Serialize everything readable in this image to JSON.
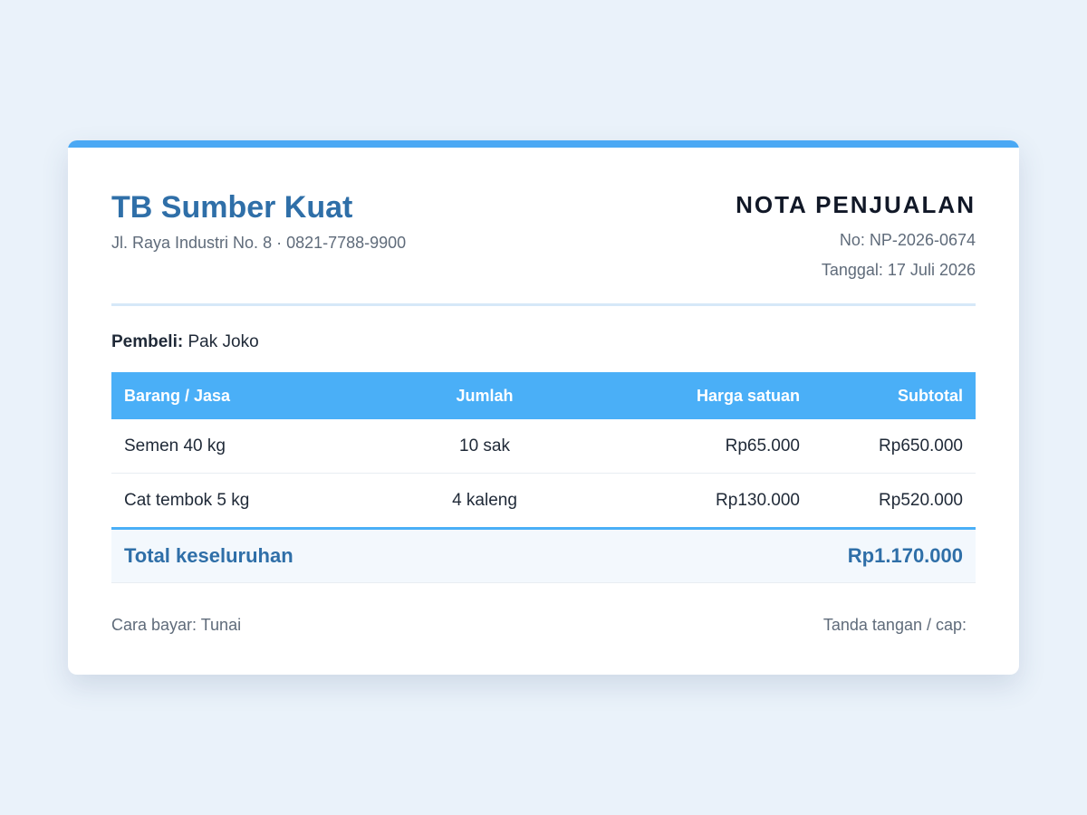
{
  "shop": {
    "name": "TB Sumber Kuat",
    "address": "Jl. Raya Industri No. 8 · 0821-7788-9900"
  },
  "document": {
    "title": "NOTA PENJUALAN",
    "number": "No: NP-2026-0674",
    "date": "Tanggal: 17 Juli 2026"
  },
  "buyer": {
    "label": "Pembeli:",
    "name": "Pak Joko"
  },
  "table": {
    "headers": [
      "Barang / Jasa",
      "Jumlah",
      "Harga satuan",
      "Subtotal"
    ],
    "rows": [
      [
        "Semen 40 kg",
        "10 sak",
        "Rp65.000",
        "Rp650.000"
      ],
      [
        "Cat tembok 5 kg",
        "4 kaleng",
        "Rp130.000",
        "Rp520.000"
      ]
    ],
    "total_label": "Total keseluruhan",
    "total_value": "Rp1.170.000"
  },
  "footer": {
    "payment": "Cara bayar: Tunai",
    "signature": "Tanda tangan / cap:"
  },
  "colors": {
    "accent": "#4aa8f4",
    "brand": "#2f6fa8",
    "background": "#eaf2fa"
  }
}
